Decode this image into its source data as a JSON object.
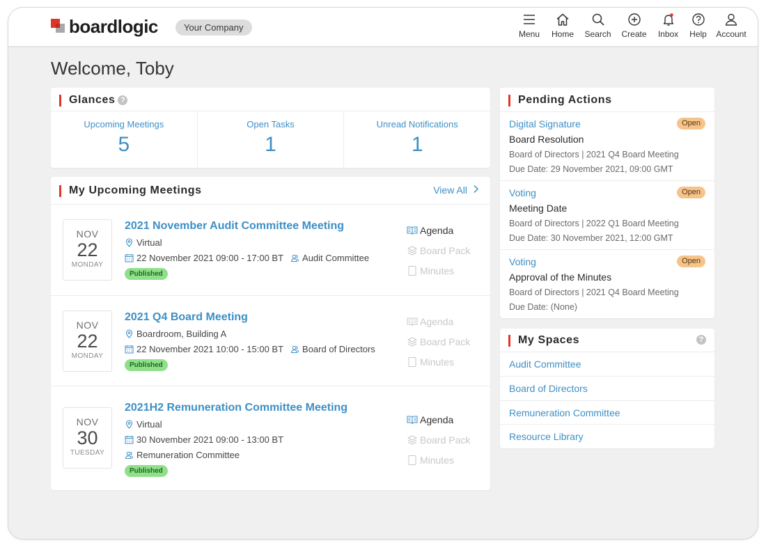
{
  "brand": {
    "logo_text": "boardlogic",
    "company": "Your Company"
  },
  "nav": [
    {
      "label": "Menu",
      "icon": "menu-icon"
    },
    {
      "label": "Home",
      "icon": "home-icon"
    },
    {
      "label": "Search",
      "icon": "search-icon"
    },
    {
      "label": "Create",
      "icon": "plus-circle-icon"
    },
    {
      "label": "Inbox",
      "icon": "bell-icon"
    },
    {
      "label": "Help",
      "icon": "question-icon"
    },
    {
      "label": "Account",
      "icon": "user-icon"
    }
  ],
  "welcome": "Welcome, Toby",
  "glances": {
    "title": "Glances",
    "items": [
      {
        "label": "Upcoming Meetings",
        "value": "5"
      },
      {
        "label": "Open Tasks",
        "value": "1"
      },
      {
        "label": "Unread Notifications",
        "value": "1"
      }
    ]
  },
  "meetings": {
    "title": "My Upcoming Meetings",
    "view_all": "View All",
    "items": [
      {
        "month": "NOV",
        "day": "22",
        "weekday": "MONDAY",
        "title": "2021 November Audit Committee Meeting",
        "location": "Virtual",
        "datetime": "22 November 2021 09:00 - 17:00 BT",
        "committee": "Audit Committee",
        "status": "Published",
        "agenda": "Agenda",
        "board_pack": "Board Pack",
        "minutes": "Minutes"
      },
      {
        "month": "NOV",
        "day": "22",
        "weekday": "MONDAY",
        "title": "2021 Q4 Board Meeting",
        "location": "Boardroom, Building A",
        "datetime": "22 November 2021 10:00 - 15:00 BT",
        "committee": "Board of Directors",
        "status": "Published",
        "agenda": "Agenda",
        "board_pack": "Board Pack",
        "minutes": "Minutes"
      },
      {
        "month": "NOV",
        "day": "30",
        "weekday": "TUESDAY",
        "title": "2021H2 Remuneration Committee Meeting",
        "location": "Virtual",
        "datetime": "30 November 2021 09:00 - 13:00 BT",
        "committee": "Remuneration Committee",
        "status": "Published",
        "agenda": "Agenda",
        "board_pack": "Board Pack",
        "minutes": "Minutes"
      }
    ]
  },
  "pending": {
    "title": "Pending Actions",
    "items": [
      {
        "type": "Digital Signature",
        "name": "Board Resolution",
        "subtitle": "Board of Directors | 2021 Q4 Board Meeting",
        "due": "Due Date: 29 November 2021, 09:00 GMT",
        "badge": "Open"
      },
      {
        "type": "Voting",
        "name": "Meeting Date",
        "subtitle": "Board of Directors | 2022 Q1 Board Meeting",
        "due": "Due Date: 30 November 2021, 12:00 GMT",
        "badge": "Open"
      },
      {
        "type": "Voting",
        "name": "Approval of the Minutes",
        "subtitle": "Board of Directors | 2021 Q4 Board Meeting",
        "due": "Due Date: (None)",
        "badge": "Open"
      }
    ]
  },
  "spaces": {
    "title": "My Spaces",
    "items": [
      "Audit Committee",
      "Board of Directors",
      "Remuneration Committee",
      "Resource Library"
    ]
  },
  "colors": {
    "accent_red": "#e0352b",
    "link_blue": "#3d8fc6",
    "published_green": "#8fdf8b",
    "open_orange": "#f6c48b"
  }
}
